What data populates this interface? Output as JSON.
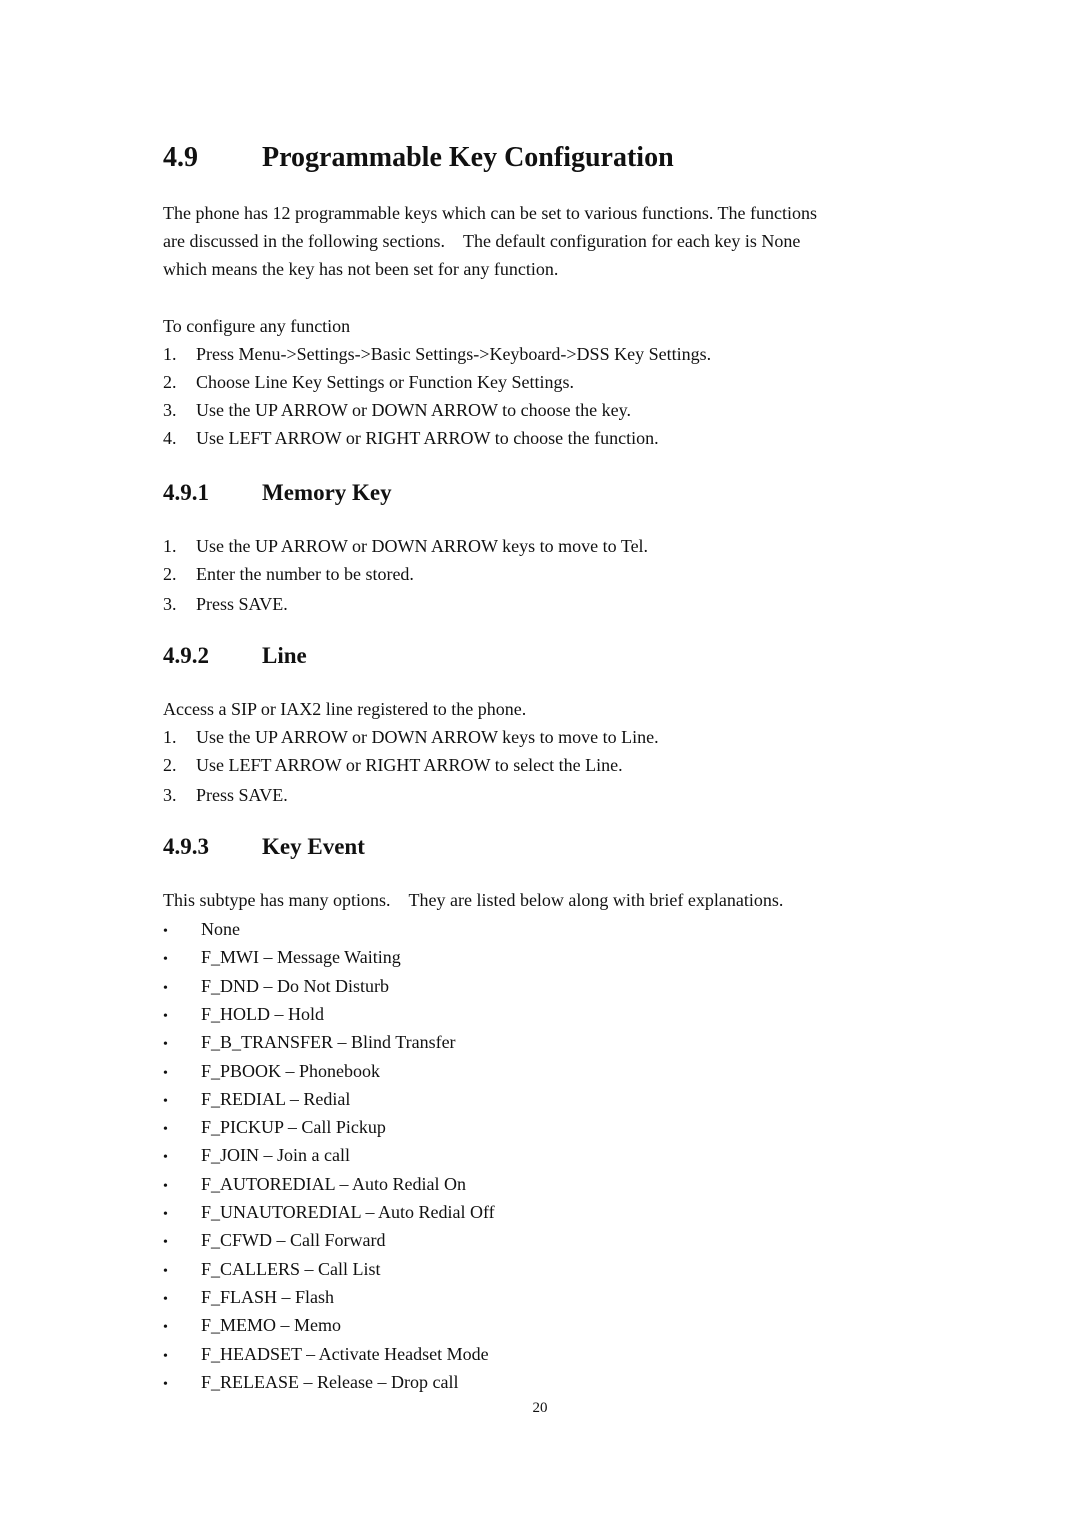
{
  "section": {
    "number": "4.9",
    "title": "Programmable Key Configuration",
    "intro_lines": [
      "The phone has 12 programmable keys which can be set to various functions. The functions",
      "are discussed in the following sections.    The default configuration for each key is None",
      "which means the key has not been set for any function."
    ],
    "configure_label": "To configure any function",
    "configure_steps": [
      {
        "n": "1.",
        "text": "Press Menu->Settings->Basic Settings->Keyboard->DSS Key Settings."
      },
      {
        "n": "2.",
        "text": "Choose Line Key Settings or Function Key Settings."
      },
      {
        "n": "3.",
        "text": "Use the UP ARROW or DOWN ARROW to choose the key."
      },
      {
        "n": "4.",
        "text": "Use LEFT ARROW or RIGHT ARROW to choose the function."
      }
    ]
  },
  "memory_key": {
    "number": "4.9.1",
    "title": "Memory Key",
    "steps": [
      {
        "n": "1.",
        "text": "Use the UP ARROW or DOWN ARROW keys to move to Tel."
      },
      {
        "n": "2.",
        "text": "Enter the number to be stored."
      },
      {
        "n": "3.",
        "text": "Press SAVE."
      }
    ]
  },
  "line": {
    "number": "4.9.2",
    "title": "Line",
    "intro": "Access a SIP or IAX2 line registered to the phone.",
    "steps": [
      {
        "n": "1.",
        "text": "Use the UP ARROW or DOWN ARROW keys to move to Line."
      },
      {
        "n": "2.",
        "text": "Use LEFT ARROW or RIGHT ARROW to select the Line."
      },
      {
        "n": "3.",
        "text": "Press SAVE."
      }
    ]
  },
  "key_event": {
    "number": "4.9.3",
    "title": "Key Event",
    "intro": "This subtype has many options.    They are listed below along with brief explanations.",
    "bullet_glyph": "•",
    "options": [
      "None",
      "F_MWI – Message Waiting",
      "F_DND – Do Not Disturb",
      "F_HOLD – Hold",
      "F_B_TRANSFER – Blind Transfer",
      "F_PBOOK – Phonebook",
      "F_REDIAL – Redial",
      "F_PICKUP – Call Pickup",
      "F_JOIN – Join a call",
      "F_AUTOREDIAL – Auto Redial On",
      "F_UNAUTOREDIAL – Auto Redial Off",
      "F_CFWD – Call Forward",
      "F_CALLERS – Call List",
      "F_FLASH – Flash",
      "F_MEMO – Memo",
      "F_HEADSET – Activate Headset Mode",
      "F_RELEASE – Release – Drop call"
    ]
  },
  "footer": {
    "page_number": "20"
  }
}
